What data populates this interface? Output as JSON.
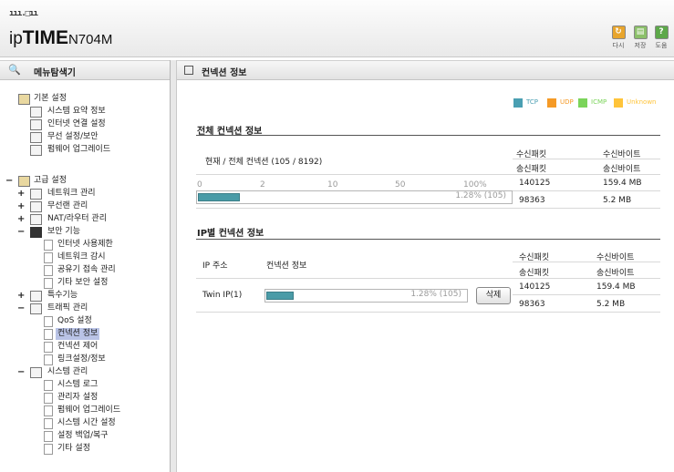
{
  "header": {
    "logo_dots": "ııı.□ıı",
    "brand_ip": "ip",
    "brand_time": "TIME",
    "brand_model": "N704M",
    "toolbar": [
      {
        "label": "다시",
        "icon": "refresh-icon"
      },
      {
        "label": "저장",
        "icon": "save-icon"
      },
      {
        "label": "도움",
        "icon": "help-icon"
      }
    ]
  },
  "sidebar": {
    "title": "메뉴탐색기",
    "tree": {
      "basic": "기본 설정",
      "basic_items": [
        "시스템 요약 정보",
        "인터넷 연결 설정",
        "무선 설정/보안",
        "펌웨어 업그레이드"
      ],
      "advanced": "고급 설정",
      "network": "네트워크 관리",
      "wireless": "무선랜 관리",
      "nat": "NAT/라우터 관리",
      "security": "보안 기능",
      "security_items": [
        "인터넷 사용제한",
        "네트워크 감시",
        "공유기 접속 관리",
        "기타 보안 설정"
      ],
      "special": "특수기능",
      "traffic": "트래픽 관리",
      "traffic_items": [
        "QoS 설정",
        "컨넥션 정보",
        "컨넥션 제어",
        "링크설정/정보"
      ],
      "system": "시스템 관리",
      "system_items": [
        "시스템 로그",
        "관리자 설정",
        "펌웨어 업그레이드",
        "시스템 시간 설정",
        "설정 백업/복구",
        "기타 설정"
      ]
    }
  },
  "main": {
    "title": "컨넥션 정보",
    "legend": [
      {
        "label": "TCP",
        "color": "#4a9fb2"
      },
      {
        "label": "UDP",
        "color": "#f59a26"
      },
      {
        "label": "ICMP",
        "color": "#7bd45a"
      },
      {
        "label": "Unknown",
        "color": "#ffc43a"
      }
    ],
    "total": {
      "section_title": "전체 컨넥션 정보",
      "label": "현재 / 전체 컨넥션 (105 / 8192)",
      "scale": [
        "0",
        "2",
        "10",
        "50",
        "100%"
      ],
      "percent_text": "1.28% (105)",
      "fill_fraction": 0.128,
      "col_rx_pkt": "수신패킷",
      "col_tx_pkt": "송신패킷",
      "col_rx_byte": "수신바이트",
      "col_tx_byte": "송신바이트",
      "rx_pkt": "140125",
      "rx_byte": "159.4 MB",
      "tx_pkt": "98363",
      "tx_byte": "5.2 MB"
    },
    "per_ip": {
      "section_title": "IP별 컨넥션 정보",
      "col_ip": "IP 주소",
      "col_conn": "컨넥션 정보",
      "col_rx_pkt": "수신패킷",
      "col_tx_pkt": "송신패킷",
      "col_rx_byte": "수신바이트",
      "col_tx_byte": "송신바이트",
      "rows": [
        {
          "ip": "Twin IP(1)",
          "percent_text": "1.28% (105)",
          "fill_fraction": 0.128,
          "delete_label": "삭제",
          "rx_pkt": "140125",
          "rx_byte": "159.4 MB",
          "tx_pkt": "98363",
          "tx_byte": "5.2 MB"
        }
      ]
    }
  }
}
